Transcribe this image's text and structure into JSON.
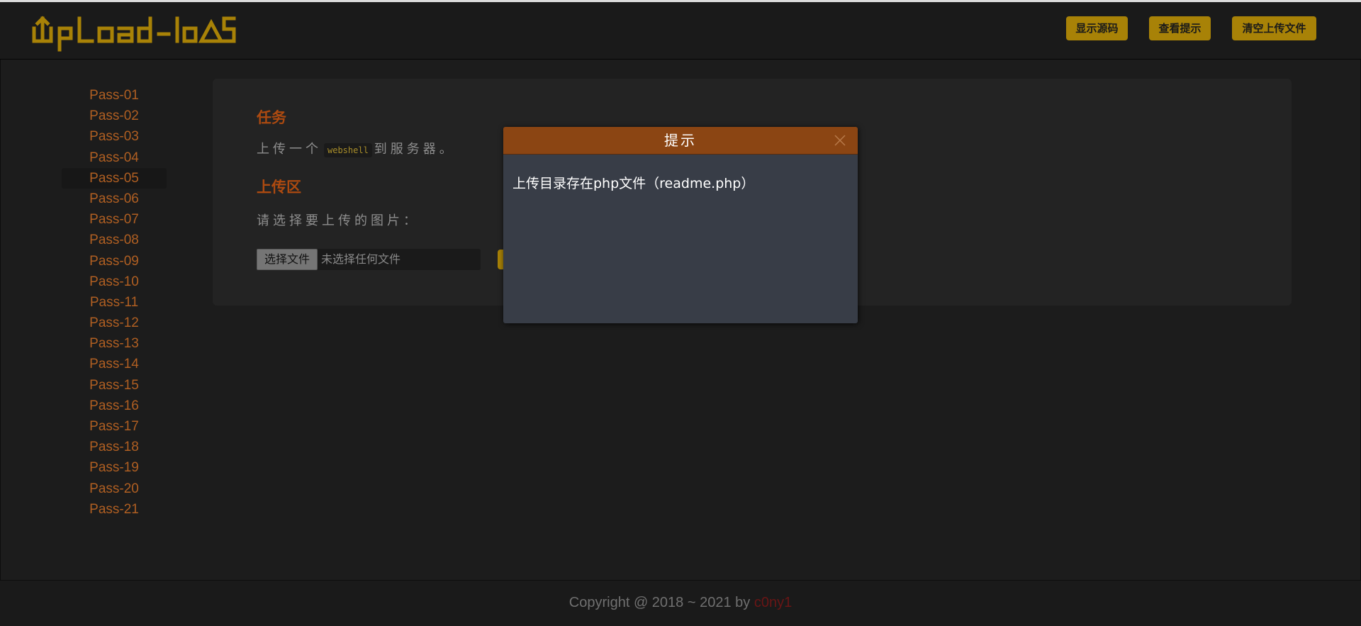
{
  "header": {
    "logo": "UpLoad-labS",
    "buttons": [
      {
        "label": "显示源码"
      },
      {
        "label": "查看提示"
      },
      {
        "label": "清空上传文件"
      }
    ]
  },
  "sidebar": {
    "active": "Pass-05",
    "items": [
      "Pass-01",
      "Pass-02",
      "Pass-03",
      "Pass-04",
      "Pass-05",
      "Pass-06",
      "Pass-07",
      "Pass-08",
      "Pass-09",
      "Pass-10",
      "Pass-11",
      "Pass-12",
      "Pass-13",
      "Pass-14",
      "Pass-15",
      "Pass-16",
      "Pass-17",
      "Pass-18",
      "Pass-19",
      "Pass-20",
      "Pass-21"
    ]
  },
  "task": {
    "title": "任务",
    "text_before": "上传一个",
    "code": "webshell",
    "text_after": "到服务器。"
  },
  "upload": {
    "title": "上传区",
    "prompt": "请选择要上传的图片：",
    "choose_label": "选择文件",
    "no_file": "未选择任何文件"
  },
  "dialog": {
    "title": "提示",
    "message": "上传目录存在php文件（readme.php）"
  },
  "footer": {
    "copyright": "Copyright @ 2018 ~ 2021 by",
    "author": "c0ny1"
  },
  "colors": {
    "accent_gold": "#a88207",
    "accent_orange": "#b05f22",
    "dialog_header": "#8b4513",
    "dialog_body": "#383d47"
  }
}
